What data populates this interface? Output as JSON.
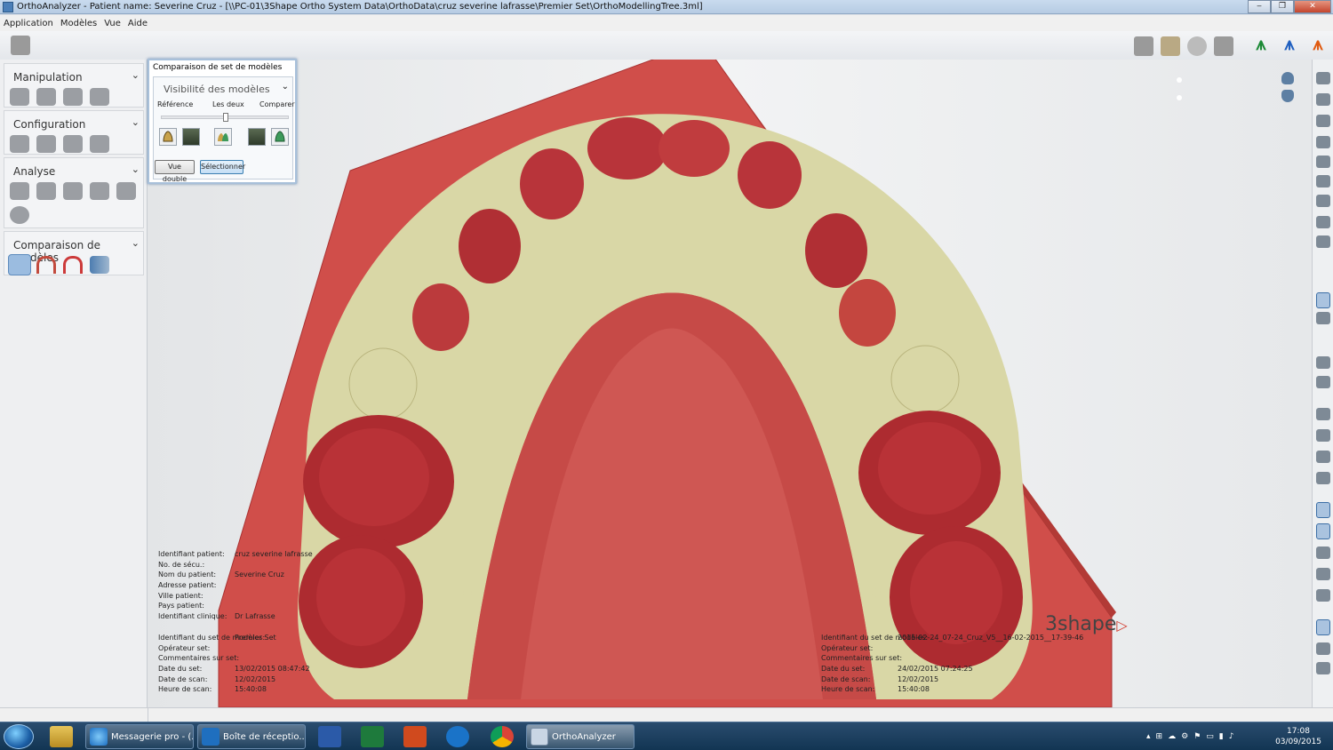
{
  "window": {
    "title": "OrthoAnalyzer - Patient name: Severine Cruz - [\\\\PC-01\\3Shape Ortho System Data\\OrthoData\\cruz severine lafrasse\\Premier Set\\OrthoModellingTree.3ml]",
    "minimize_icon": "minimize-icon",
    "maximize_icon": "maximize-icon",
    "close_icon": "close-icon"
  },
  "menu": [
    "Application",
    "Modèles",
    "Vue",
    "Aide"
  ],
  "sidebar": {
    "sections": [
      {
        "title": "Manipulation",
        "icons": [
          "tooth-cut-icon",
          "tooth-shape-icon",
          "tooth-trim-icon",
          "arch-icon"
        ]
      },
      {
        "title": "Configuration",
        "icons": [
          "axis-setup-icon",
          "base-icon",
          "socle-icon",
          "tooth-setup-icon"
        ]
      },
      {
        "title": "Analyse",
        "icons": [
          "arch-measure-icon",
          "space-analysis-icon",
          "occlusion-icon",
          "cross-section-icon",
          "model-measure-icon",
          "tooth-analysis-icon"
        ]
      },
      {
        "title": "Comparaison de modèles",
        "icons": [
          "model-compare-icon",
          "superimpose-icon",
          "magnet-icon",
          "color-map-icon"
        ]
      }
    ]
  },
  "comparison_panel": {
    "title": "Comparaison de set de modèles",
    "visibility_label": "Visibilité des modèles",
    "labels": {
      "reference": "Référence",
      "both": "Les deux",
      "compare": "Comparer"
    },
    "slider_value_fraction": 0.5,
    "model_buttons": [
      "reference-model-icon",
      "reference-photo-icon",
      "both-models-icon",
      "compare-photo-icon",
      "compare-model-icon"
    ],
    "buttons": {
      "dual_view": "Vue double",
      "select": "Sélectionner"
    }
  },
  "patient_info": {
    "rows": [
      {
        "label": "Identifiant patient:",
        "value": "cruz severine lafrasse"
      },
      {
        "label": "No. de sécu.:",
        "value": ""
      },
      {
        "label": "Nom du patient:",
        "value": "Severine Cruz"
      },
      {
        "label": "Adresse patient:",
        "value": ""
      },
      {
        "label": "Ville patient:",
        "value": ""
      },
      {
        "label": "Pays patient:",
        "value": ""
      },
      {
        "label": "Identifiant clinique:",
        "value": "Dr Lafrasse"
      }
    ]
  },
  "reference_set": {
    "rows": [
      {
        "label": "Identifiant du set de modèles:",
        "value": "Premier Set"
      },
      {
        "label": "Opérateur set:",
        "value": ""
      },
      {
        "label": "Commentaires sur set:",
        "value": ""
      },
      {
        "label": "Date du set:",
        "value": "13/02/2015 08:47:42"
      },
      {
        "label": "Date de scan:",
        "value": "12/02/2015"
      },
      {
        "label": "Heure de scan:",
        "value": "15:40:08"
      }
    ]
  },
  "compare_set": {
    "rows": [
      {
        "label": "Identifiant du set de modèles:",
        "value": "2015-02-24_07-24_Cruz_V5__16-02-2015__17-39-46"
      },
      {
        "label": "Opérateur set:",
        "value": ""
      },
      {
        "label": "Commentaires sur set:",
        "value": ""
      },
      {
        "label": "Date du set:",
        "value": "24/02/2015 07:24:25"
      },
      {
        "label": "Date de scan:",
        "value": "12/02/2015"
      },
      {
        "label": "Heure de scan:",
        "value": "15:40:08"
      }
    ]
  },
  "brand": {
    "name": "3shape",
    "mark": "▷"
  },
  "colors": {
    "model_red": "#c0403e",
    "model_cream": "#d9d8a8",
    "base_red": "#d2524e"
  },
  "taskbar": {
    "items": [
      {
        "label": "Messagerie pro - (...",
        "icon": "ie-icon"
      },
      {
        "label": "Boîte de réceptio...",
        "icon": "outlook-icon"
      },
      {
        "label": "OrthoAnalyzer",
        "icon": "orthoanalyzer-icon"
      }
    ],
    "pinned": [
      "explorer-icon",
      "word-icon",
      "excel-icon",
      "powerpoint-icon",
      "teamviewer-icon",
      "chrome-icon"
    ],
    "clock_time": "17:08",
    "clock_date": "03/09/2015"
  }
}
